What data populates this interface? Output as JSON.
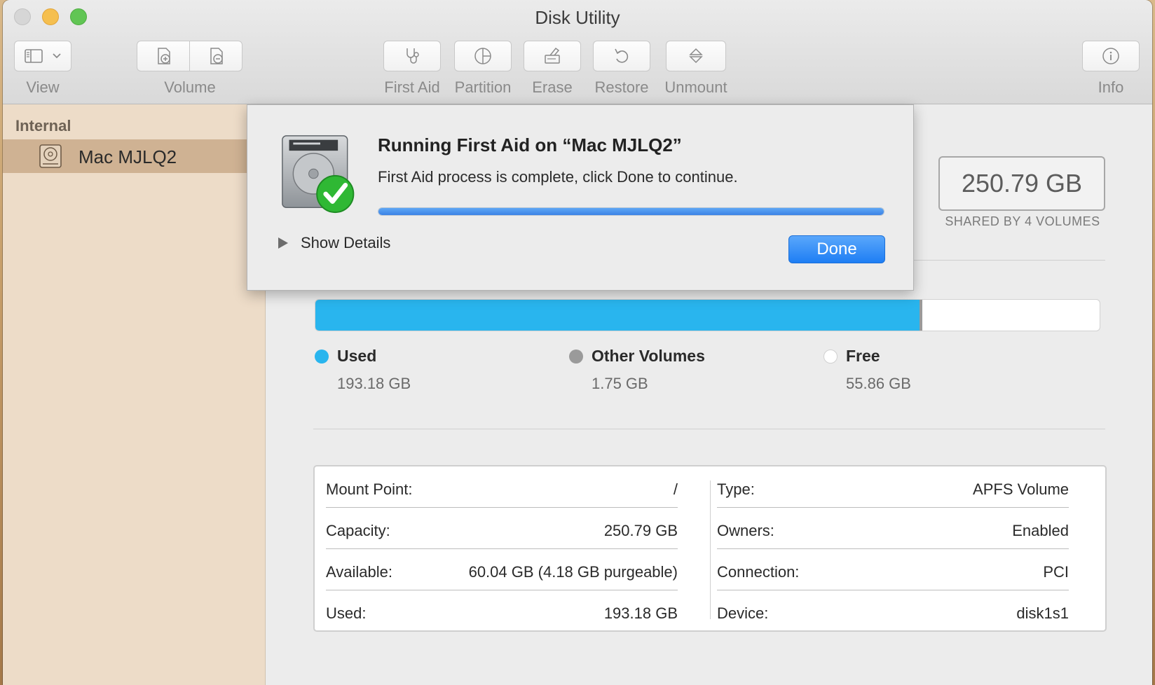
{
  "window": {
    "title": "Disk Utility"
  },
  "toolbar": {
    "view_label": "View",
    "volume_label": "Volume",
    "first_aid_label": "First Aid",
    "partition_label": "Partition",
    "erase_label": "Erase",
    "restore_label": "Restore",
    "unmount_label": "Unmount",
    "info_label": "Info"
  },
  "sidebar": {
    "section": "Internal",
    "items": [
      {
        "label": "Mac MJLQ2",
        "icon": "internal-disk-icon",
        "selected": true
      }
    ]
  },
  "dialog": {
    "title": "Running First Aid on “Mac MJLQ2”",
    "message": "First Aid process is complete, click Done to continue.",
    "progress": 1.0,
    "show_details": "Show Details",
    "done": "Done",
    "icon": "disk-checkmark-icon"
  },
  "capacity": {
    "value": "250.79 GB",
    "subtitle": "SHARED BY 4 VOLUMES"
  },
  "usage": {
    "used_fraction": 0.7703,
    "other_fraction": 0.0035,
    "legend": [
      {
        "name": "Used",
        "value": "193.18 GB",
        "color": "#29b5ee"
      },
      {
        "name": "Other Volumes",
        "value": "1.75 GB",
        "color": "#9a9a9a"
      },
      {
        "name": "Free",
        "value": "55.86 GB",
        "color": "#ffffff"
      }
    ]
  },
  "info": {
    "left": [
      {
        "key": "Mount Point:",
        "value": "/"
      },
      {
        "key": "Capacity:",
        "value": "250.79 GB"
      },
      {
        "key": "Available:",
        "value": "60.04 GB (4.18 GB purgeable)"
      },
      {
        "key": "Used:",
        "value": "193.18 GB"
      }
    ],
    "right": [
      {
        "key": "Type:",
        "value": "APFS Volume"
      },
      {
        "key": "Owners:",
        "value": "Enabled"
      },
      {
        "key": "Connection:",
        "value": "PCI"
      },
      {
        "key": "Device:",
        "value": "disk1s1"
      }
    ]
  },
  "colors": {
    "accent": "#1e7ef4",
    "used": "#29b5ee",
    "other": "#9a9a9a",
    "free": "#ffffff",
    "success": "#2fb834"
  }
}
